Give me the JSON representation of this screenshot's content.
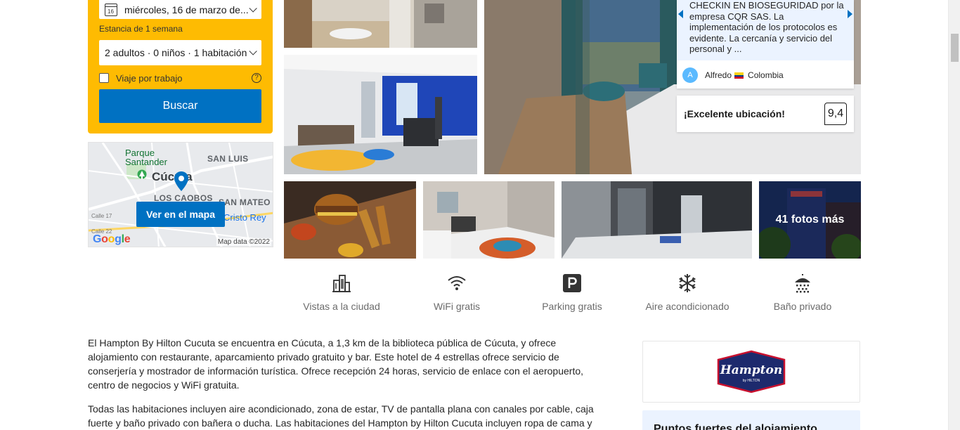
{
  "search": {
    "checkout_date": "miércoles, 16 de marzo de...",
    "calendar_day": "16",
    "stay_length": "Estancia de 1 semana",
    "guests": "2 adultos · 0 niños · 1 habitación",
    "work_trip_label": "Viaje por trabajo",
    "help_symbol": "?",
    "search_button": "Buscar",
    "colors": {
      "panel": "#febb02",
      "button": "#0071c2"
    }
  },
  "map": {
    "labels": {
      "park": "Parque\nSantander",
      "park_line1": "Parque",
      "park_line2": "Santander",
      "city": "Cúcuta",
      "san_luis": "SAN LUIS",
      "caobos": "LOS CAOBOS",
      "san_mateo": "SAN MATEO",
      "cristo_rey": "Cristo Rey",
      "calle_17": "Calle 17",
      "calle_22": "Calle 22"
    },
    "button": "Ver en el mapa",
    "google": [
      "G",
      "o",
      "o",
      "g",
      "l",
      "e"
    ],
    "copyright": "Map data ©2022"
  },
  "photos": {
    "more_label": "41 fotos más"
  },
  "review": {
    "text": "CHECKIN EN BIOSEGURIDAD por la empresa CQR SAS. La implementación de los protocolos es evidente. La cercanía y servicio del personal y ...",
    "reviewer_initial": "A",
    "reviewer_name": "Alfredo",
    "reviewer_country": "Colombia"
  },
  "rating": {
    "label": "¡Excelente ubicación!",
    "score": "9,4"
  },
  "facilities": [
    {
      "label": "Vistas a la ciudad",
      "icon": "city-view-icon"
    },
    {
      "label": "WiFi gratis",
      "icon": "wifi-icon"
    },
    {
      "label": "Parking gratis",
      "icon": "parking-icon"
    },
    {
      "label": "Aire acondicionado",
      "icon": "snowflake-icon"
    },
    {
      "label": "Baño privado",
      "icon": "shower-icon"
    }
  ],
  "description": {
    "paragraph1": "El Hampton By Hilton Cucuta se encuentra en Cúcuta, a 1,3 km de la biblioteca pública de Cúcuta, y ofrece alojamiento con restaurante, aparcamiento privado gratuito y bar. Este hotel de 4 estrellas ofrece servicio de conserjería y mostrador de información turística. Ofrece recepción 24 horas, servicio de enlace con el aeropuerto, centro de negocios y WiFi gratuita.",
    "paragraph2": "Todas las habitaciones incluyen aire acondicionado, zona de estar, TV de pantalla plana con canales por cable, caja fuerte y baño privado con bañera o ducha. Las habitaciones del Hampton by Hilton Cucuta incluyen ropa de cama y"
  },
  "brand": {
    "name": "Hampton",
    "sub": "by HILTON"
  },
  "highlights": {
    "title": "Puntos fuertes del alojamiento"
  }
}
